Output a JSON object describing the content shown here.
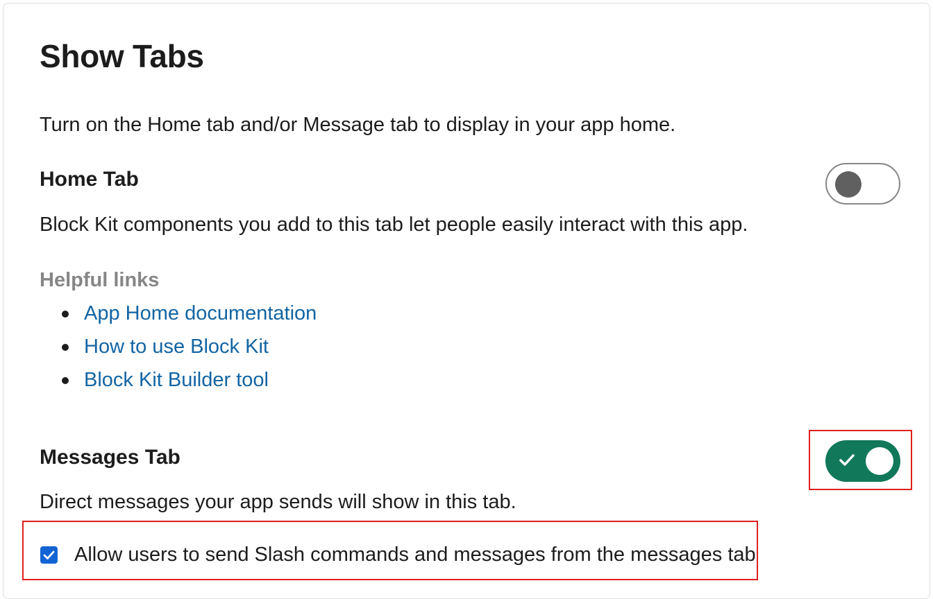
{
  "page": {
    "title": "Show Tabs",
    "intro": "Turn on the Home tab and/or Message tab to display in your app home."
  },
  "home_tab": {
    "title": "Home Tab",
    "description": "Block Kit components you add to this tab let people easily interact with this app.",
    "toggle_on": false,
    "helpful_links_label": "Helpful links",
    "links": [
      {
        "label": "App Home documentation"
      },
      {
        "label": "How to use Block Kit"
      },
      {
        "label": "Block Kit Builder tool"
      }
    ]
  },
  "messages_tab": {
    "title": "Messages Tab",
    "description": "Direct messages your app sends will show in this tab.",
    "toggle_on": true,
    "checkbox_label": "Allow users to send Slash commands and messages from the messages tab",
    "checkbox_checked": true
  },
  "colors": {
    "toggle_on": "#11785a",
    "link": "#1264a3",
    "checkbox": "#1264d4",
    "highlight": "#e0201e"
  }
}
